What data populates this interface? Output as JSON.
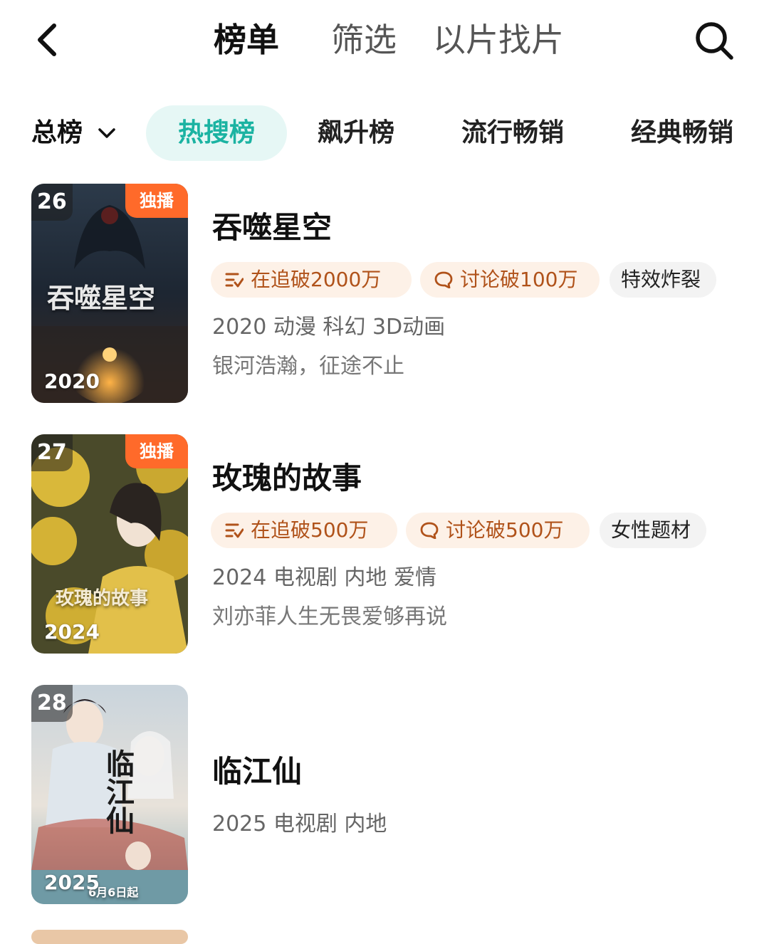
{
  "header": {
    "tabs": [
      "榜单",
      "筛选",
      "以片找片"
    ],
    "back_icon": "chevron-left-icon",
    "search_icon": "search-icon"
  },
  "categories": {
    "dropdown_label": "总榜",
    "items": [
      "热搜榜",
      "飙升榜",
      "流行畅销",
      "经典畅销"
    ],
    "active_color": "#1bb3a2",
    "active_bg": "#e6f7f5"
  },
  "items": [
    {
      "rank": "26",
      "badge": "独播",
      "poster_year": "2020",
      "poster_title": "吞噬星空",
      "title": "吞噬星空",
      "follow": "在追破2000万",
      "discuss": "讨论破100万",
      "tag": "特效炸裂",
      "meta": "2020 动漫 科幻 3D动画",
      "tagline": "银河浩瀚，征途不止"
    },
    {
      "rank": "27",
      "badge": "独播",
      "poster_year": "2024",
      "poster_title": "玫瑰的故事",
      "title": "玫瑰的故事",
      "follow": "在追破500万",
      "discuss": "讨论破500万",
      "tag": "女性题材",
      "meta": "2024 电视剧 内地 爱情",
      "tagline": "刘亦菲人生无畏爱够再说"
    },
    {
      "rank": "28",
      "poster_year": "2025",
      "poster_title": "临江仙",
      "poster_date": "6月6日起",
      "title": "临江仙",
      "meta": "2025 电视剧 内地"
    }
  ],
  "colors": {
    "badge": "#ff6a2a",
    "chip_bg": "#fdf1e7",
    "chip_text": "#b0521a"
  }
}
